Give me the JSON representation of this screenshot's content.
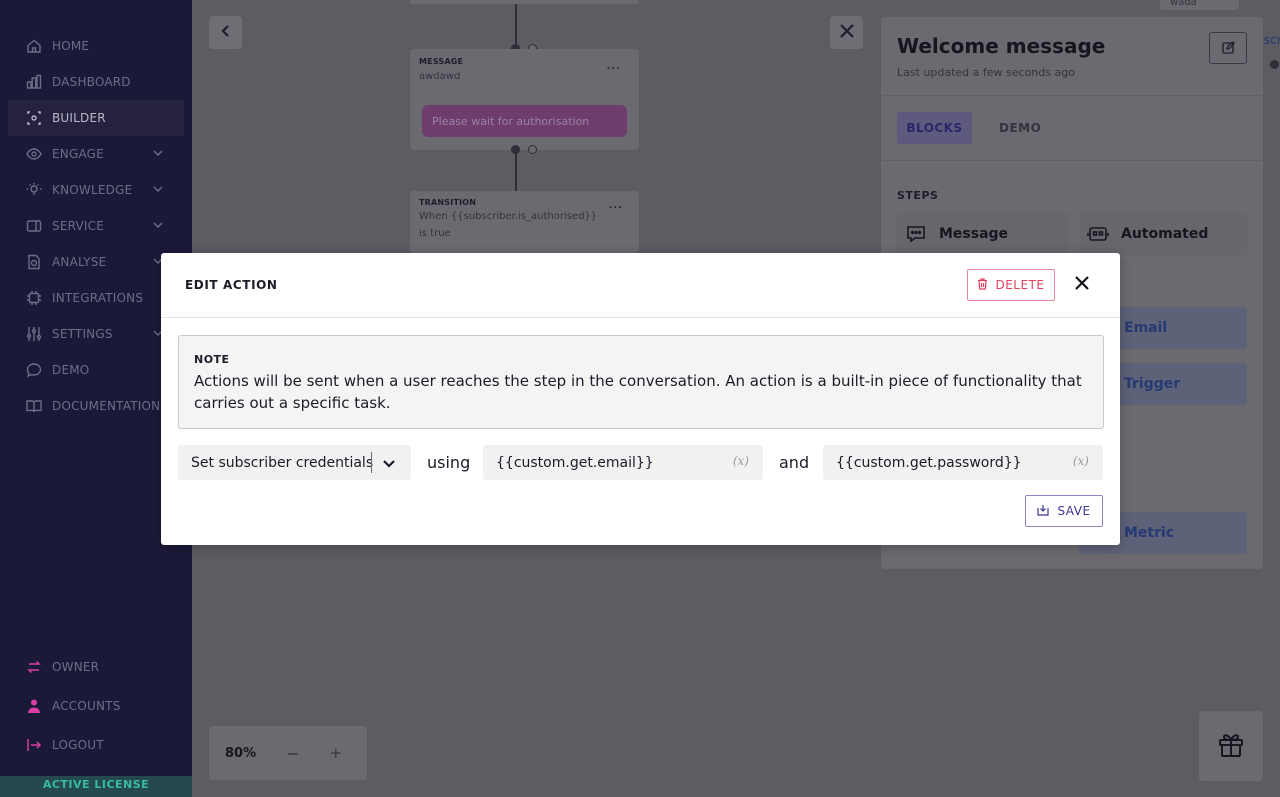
{
  "sidebar": {
    "items": [
      {
        "label": "HOME"
      },
      {
        "label": "DASHBOARD"
      },
      {
        "label": "BUILDER"
      },
      {
        "label": "ENGAGE"
      },
      {
        "label": "KNOWLEDGE"
      },
      {
        "label": "SERVICE"
      },
      {
        "label": "ANALYSE"
      },
      {
        "label": "INTEGRATIONS"
      },
      {
        "label": "SETTINGS"
      },
      {
        "label": "DEMO"
      },
      {
        "label": "DOCUMENTATION"
      }
    ],
    "bottom_items": [
      {
        "label": "OWNER"
      },
      {
        "label": "ACCOUNTS"
      },
      {
        "label": "LOGOUT"
      }
    ],
    "license": "ACTIVE LICENSE"
  },
  "flow": {
    "message_card": {
      "title": "MESSAGE",
      "subtitle": "awdawd",
      "bubble": "Please wait for authorisation",
      "menu": "..."
    },
    "transition_card": {
      "title": "TRANSITION",
      "line1": "When {{subscriber.is_authorised}}",
      "line2": "is true",
      "menu": "..."
    },
    "top_right_label": "wada",
    "edge_label": "scr"
  },
  "panel": {
    "title": "Welcome message",
    "updated": "Last updated a few seconds ago",
    "tabs": [
      {
        "label": "BLOCKS"
      },
      {
        "label": "DEMO"
      }
    ],
    "steps_label": "STEPS",
    "steps": [
      {
        "label": "Message"
      },
      {
        "label": "Automated"
      },
      {
        "label": "Email"
      },
      {
        "label": "Trigger"
      },
      {
        "label": "Metric"
      }
    ]
  },
  "zoom": {
    "value": "80%",
    "minus": "−",
    "plus": "+"
  },
  "modal": {
    "title": "EDIT ACTION",
    "delete_label": "DELETE",
    "note_label": "NOTE",
    "note_text": "Actions will be sent when a user reaches the step in the conversation. An action is a built-in piece of functionality that carries out a specific task.",
    "action_select": "Set subscriber credentials",
    "word_using": "using",
    "word_and": "and",
    "email_value": "{{custom.get.email}}",
    "password_value": "{{custom.get.password}}",
    "variable_icon": "(x)",
    "save_label": "SAVE"
  },
  "colors": {
    "accent_purple": "#3d3796",
    "delete_red": "#e0405c",
    "sidebar_bg": "#1b1938",
    "license_green": "#3bb9a7"
  }
}
